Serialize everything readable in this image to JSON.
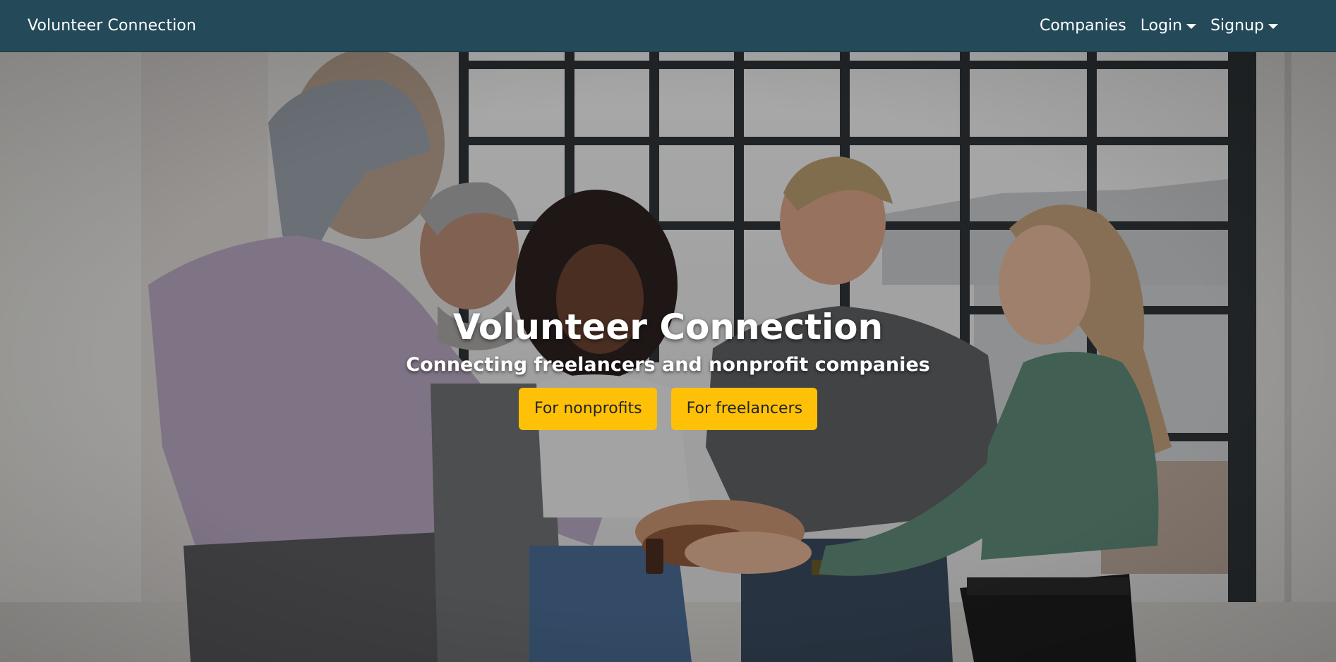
{
  "navbar": {
    "brand": "Volunteer Connection",
    "links": [
      {
        "label": "Companies",
        "has_dropdown": false
      },
      {
        "label": "Login",
        "has_dropdown": true
      },
      {
        "label": "Signup",
        "has_dropdown": true
      }
    ]
  },
  "hero": {
    "title": "Volunteer Connection",
    "subtitle": "Connecting freelancers and nonprofit companies",
    "buttons": {
      "nonprofits": "For nonprofits",
      "freelancers": "For freelancers"
    }
  },
  "colors": {
    "navbar_bg": "#244a5a",
    "button_bg": "#ffc107",
    "button_text": "#212529"
  }
}
